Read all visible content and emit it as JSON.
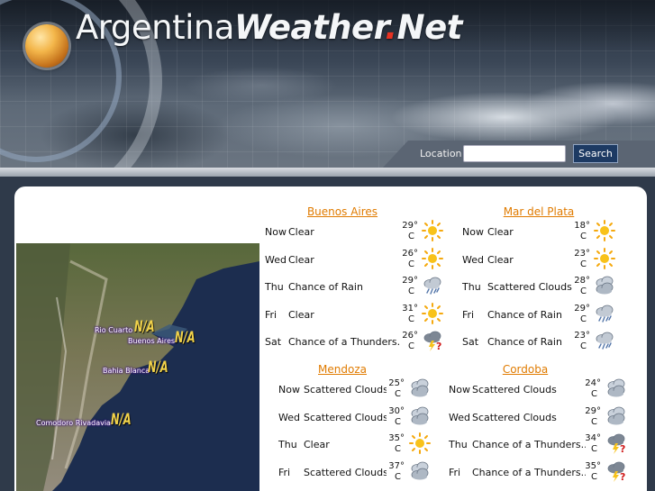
{
  "site": {
    "logo_part1": "Argentina",
    "logo_part2": "Weather",
    "logo_dot": ".",
    "logo_part3": "Net"
  },
  "search": {
    "label": "Location",
    "placeholder": "",
    "value": "",
    "button_label": "Search"
  },
  "map": {
    "labels": [
      {
        "name": "Rio Cuarto",
        "value": "N/A"
      },
      {
        "name": "Buenos Aires",
        "value": "N/A"
      },
      {
        "name": "Bahia Blanca",
        "value": "N/A"
      },
      {
        "name": "Comodoro Rivadavia",
        "value": "N/A"
      }
    ]
  },
  "cities": [
    {
      "name": "Buenos Aires",
      "rows": [
        {
          "day": "Now",
          "condition": "Clear",
          "temp": "29°",
          "unit": "C",
          "icon": "sun-icon"
        },
        {
          "day": "Wed",
          "condition": "Clear",
          "temp": "26°",
          "unit": "C",
          "icon": "sun-icon"
        },
        {
          "day": "Thu",
          "condition": "Chance of Rain",
          "temp": "29°",
          "unit": "C",
          "icon": "rain-icon"
        },
        {
          "day": "Fri",
          "condition": "Clear",
          "temp": "31°",
          "unit": "C",
          "icon": "sun-icon"
        },
        {
          "day": "Sat",
          "condition": "Chance of a Thunders...",
          "temp": "26°",
          "unit": "C",
          "icon": "thunderstorm-icon"
        }
      ]
    },
    {
      "name": "Mar del Plata",
      "rows": [
        {
          "day": "Now",
          "condition": "Clear",
          "temp": "18°",
          "unit": "C",
          "icon": "sun-icon"
        },
        {
          "day": "Wed",
          "condition": "Clear",
          "temp": "23°",
          "unit": "C",
          "icon": "sun-icon"
        },
        {
          "day": "Thu",
          "condition": "Scattered Clouds",
          "temp": "28°",
          "unit": "C",
          "icon": "clouds-icon"
        },
        {
          "day": "Fri",
          "condition": "Chance of Rain",
          "temp": "29°",
          "unit": "C",
          "icon": "rain-icon"
        },
        {
          "day": "Sat",
          "condition": "Chance of Rain",
          "temp": "23°",
          "unit": "C",
          "icon": "rain-icon"
        }
      ]
    },
    {
      "name": "Mendoza",
      "rows": [
        {
          "day": "Now",
          "condition": "Scattered Clouds",
          "temp": "25°",
          "unit": "C",
          "icon": "clouds-icon"
        },
        {
          "day": "Wed",
          "condition": "Scattered Clouds",
          "temp": "30°",
          "unit": "C",
          "icon": "clouds-icon"
        },
        {
          "day": "Thu",
          "condition": "Clear",
          "temp": "35°",
          "unit": "C",
          "icon": "sun-icon"
        },
        {
          "day": "Fri",
          "condition": "Scattered Clouds",
          "temp": "37°",
          "unit": "C",
          "icon": "clouds-icon"
        }
      ]
    },
    {
      "name": "Cordoba",
      "rows": [
        {
          "day": "Now",
          "condition": "Scattered Clouds",
          "temp": "24°",
          "unit": "C",
          "icon": "clouds-icon"
        },
        {
          "day": "Wed",
          "condition": "Scattered Clouds",
          "temp": "29°",
          "unit": "C",
          "icon": "clouds-icon"
        },
        {
          "day": "Thu",
          "condition": "Chance of a Thunders...",
          "temp": "34°",
          "unit": "C",
          "icon": "thunderstorm-icon"
        },
        {
          "day": "Fri",
          "condition": "Chance of a Thunders...",
          "temp": "35°",
          "unit": "C",
          "icon": "thunderstorm-icon"
        }
      ]
    }
  ],
  "colors": {
    "city_link": "#e07b00",
    "search_button": "#1d3a63",
    "na_label": "#f1d24a",
    "page_background": "#2f3a4a"
  }
}
